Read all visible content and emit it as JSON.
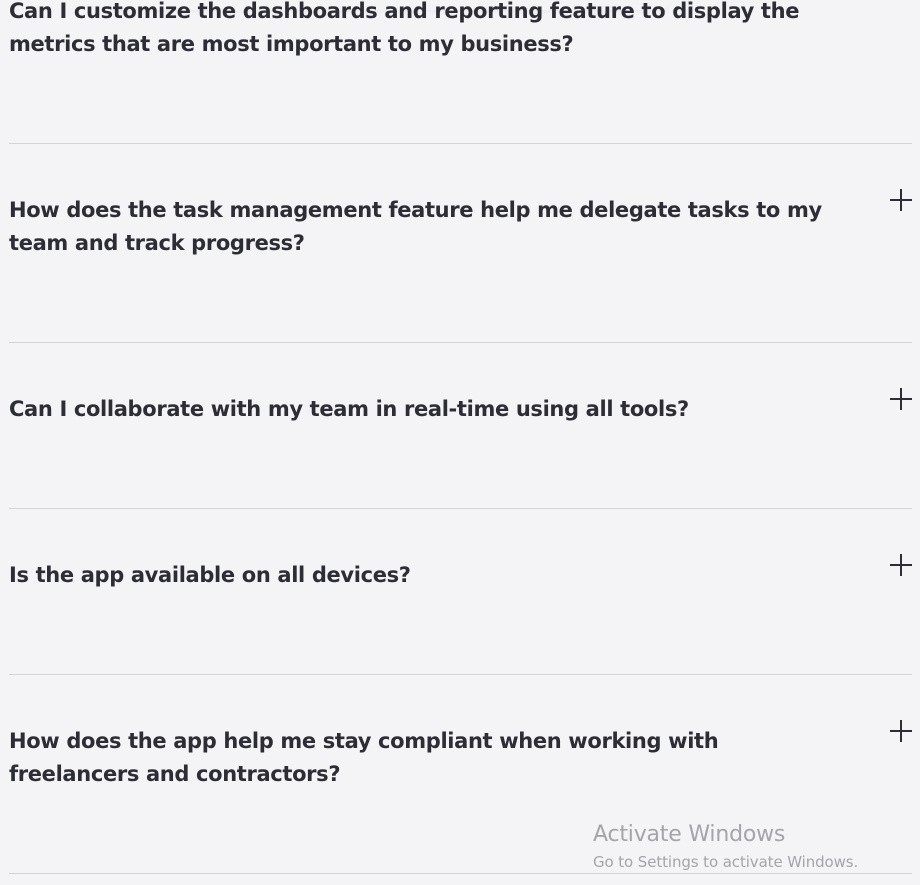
{
  "faq": {
    "items": [
      {
        "question": "Can I customize the dashboards and reporting feature to display the metrics that are most important to my business?",
        "expanded": false,
        "toggle_icon": "plus-icon"
      },
      {
        "question": "How does the task management feature help me delegate tasks to my team and track progress?",
        "expanded": false,
        "toggle_icon": "plus-icon"
      },
      {
        "question": "Can I collaborate with my team in real-time using all tools?",
        "expanded": false,
        "toggle_icon": "plus-icon"
      },
      {
        "question": "Is the app available on all devices?",
        "expanded": false,
        "toggle_icon": "plus-icon"
      },
      {
        "question": "How does the app help me stay compliant when working with freelancers and contractors?",
        "expanded": false,
        "toggle_icon": "plus-icon"
      }
    ]
  },
  "watermark": {
    "title": "Activate Windows",
    "subtitle": "Go to Settings to activate Windows."
  },
  "colors": {
    "background": "#f4f4f6",
    "text": "#2d2d35",
    "divider": "#d3d3d8",
    "watermark": "#a4a4aa"
  }
}
